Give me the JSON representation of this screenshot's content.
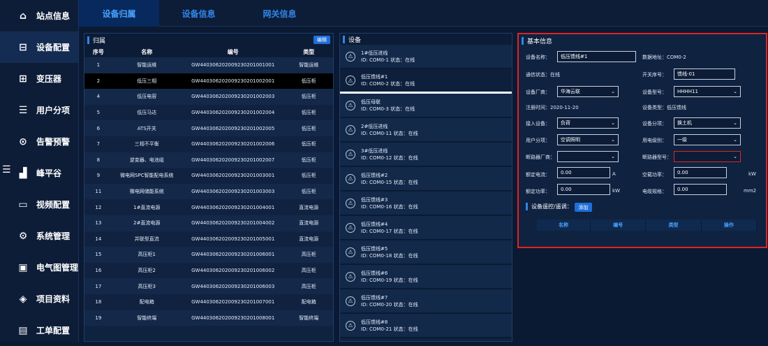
{
  "sidebar": {
    "items": [
      {
        "label": "站点信息",
        "icon": "home-icon"
      },
      {
        "label": "设备配置",
        "icon": "device-icon"
      },
      {
        "label": "变压器",
        "icon": "transformer-icon"
      },
      {
        "label": "用户分项",
        "icon": "list-icon"
      },
      {
        "label": "告警预警",
        "icon": "alarm-icon"
      },
      {
        "label": "峰平谷",
        "icon": "signal-icon"
      },
      {
        "label": "视频配置",
        "icon": "video-icon"
      },
      {
        "label": "系统管理",
        "icon": "settings-icon"
      },
      {
        "label": "电气图管理",
        "icon": "diagram-icon"
      },
      {
        "label": "项目资料",
        "icon": "layers-icon"
      },
      {
        "label": "工单配置",
        "icon": "workorder-icon"
      }
    ]
  },
  "tabs": [
    "设备归属",
    "设备信息",
    "网关信息"
  ],
  "belong": {
    "title": "归属",
    "edit_label": "编辑",
    "columns": [
      "序号",
      "名称",
      "编号",
      "类型"
    ],
    "rows": [
      [
        "1",
        "智能运维",
        "GW440306202009230201001001",
        "智能运维"
      ],
      [
        "2",
        "低压三相",
        "GW440306202009230201002001",
        "低压柜"
      ],
      [
        "4",
        "低压电容",
        "GW440306202009230201002003",
        "低压柜"
      ],
      [
        "5",
        "低压马达",
        "GW440306202009230201002004",
        "低压柜"
      ],
      [
        "6",
        "ATS开关",
        "GW440306202009230201002005",
        "低压柜"
      ],
      [
        "7",
        "三相不平衡",
        "GW440306202009230201002006",
        "低压柜"
      ],
      [
        "8",
        "逆变器、电池组",
        "GW440306202009230201002007",
        "低压柜"
      ],
      [
        "9",
        "微电网SPC智能配电系统",
        "GW440306202009230201003001",
        "低压柜"
      ],
      [
        "11",
        "微电网储能系统",
        "GW440306202009230201003003",
        "低压柜"
      ],
      [
        "12",
        "1#直流电源",
        "GW440306202009230201004001",
        "直流电源"
      ],
      [
        "13",
        "2#直流电源",
        "GW440306202009230201004002",
        "直流电源"
      ],
      [
        "14",
        "并联型直流",
        "GW440306202009230201005001",
        "直流电源"
      ],
      [
        "15",
        "高压柜1",
        "GW440306202009230201006001",
        "高压柜"
      ],
      [
        "16",
        "高压柜2",
        "GW440306202009230201006002",
        "高压柜"
      ],
      [
        "17",
        "高压柜3",
        "GW440306202009230201006003",
        "高压柜"
      ],
      [
        "18",
        "配电箱",
        "GW440306202009230201007001",
        "配电箱"
      ],
      [
        "19",
        "智能终端",
        "GW440306202009230201008001",
        "智能终端"
      ]
    ]
  },
  "devices": {
    "title": "设备",
    "items": [
      {
        "name": "1#低压进线",
        "status": "ID: COM0-1 状态：在线"
      },
      {
        "name": "低压馈线#1",
        "status": "ID: COM0-2 状态：在线"
      },
      {
        "name": "低压母联",
        "status": "ID: COM0-3 状态：在线"
      },
      {
        "name": "2#低压进线",
        "status": "ID: COM0-11 状态：在线"
      },
      {
        "name": "3#低压进线",
        "status": "ID: COM0-12 状态：在线"
      },
      {
        "name": "低压馈线#2",
        "status": "ID: COM0-15 状态：在线"
      },
      {
        "name": "低压馈线#3",
        "status": "ID: COM0-16 状态：在线"
      },
      {
        "name": "低压馈线#4",
        "status": "ID: COM0-17 状态：在线"
      },
      {
        "name": "低压馈线#5",
        "status": "ID: COM0-18 状态：在线"
      },
      {
        "name": "低压馈线#6",
        "status": "ID: COM0-19 状态：在线"
      },
      {
        "name": "低压馈线#7",
        "status": "ID: COM0-20 状态：在线"
      },
      {
        "name": "低压馈线#8",
        "status": "ID: COM0-21 状态：在线"
      }
    ]
  },
  "basic": {
    "title": "基本信息",
    "device_name_label": "设备名称：",
    "device_name_value": "低压馈线#1",
    "data_addr": "数据地址：COM0-2",
    "comm_status": "通信状态：在线",
    "switch_no_label": "开关序号：",
    "switch_no_value": "馈线-01",
    "vendor_label": "设备厂商：",
    "vendor_value": "华海云联",
    "model_label": "设备型号：",
    "model_value": "HHHH11",
    "reg_time": "注册时间：2020-11-20",
    "dev_type": "设备类型：低压馈线",
    "access_label": "接入设备：",
    "access_value": "负荷",
    "group_label": "设备分项：",
    "group_value": "换土机",
    "user_label": "用户分项：",
    "user_value": "空调照明",
    "level_label": "用电级别：",
    "level_value": "一级",
    "breaker_vendor_label": "断路器厂商：",
    "breaker_model_label": "断路器型号：",
    "rated_current_label": "额定电流：",
    "rated_current_value": "0.00",
    "rated_current_unit": "A",
    "noload_label": "空载功率：",
    "noload_value": "0.00",
    "noload_unit": "kW",
    "rated_power_label": "额定功率：",
    "rated_power_value": "0.00",
    "rated_power_unit": "kW",
    "cable_label": "电缆规格：",
    "cable_value": "0.00",
    "cable_unit": "mm2",
    "remote_label": "设备遥控/遥调：",
    "add_label": "添加",
    "remote_columns": [
      "名称",
      "编号",
      "类型",
      "操作"
    ]
  }
}
